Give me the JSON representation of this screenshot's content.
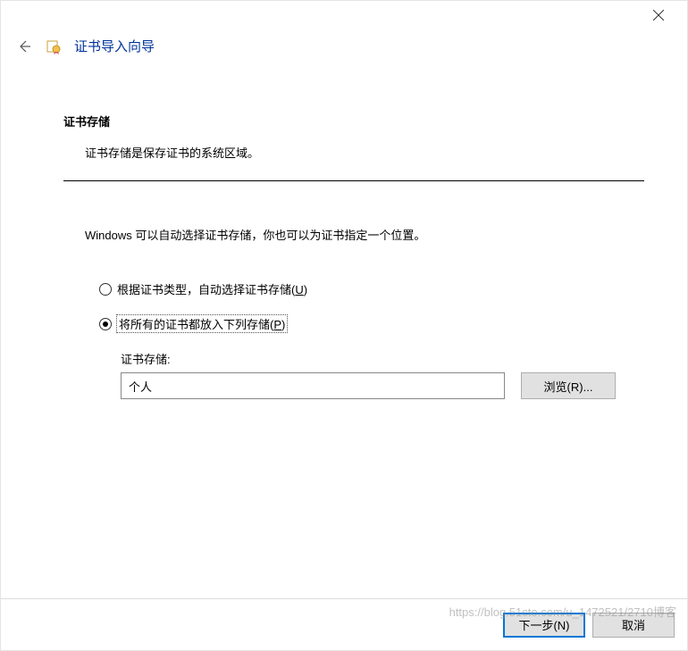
{
  "window": {
    "wizard_title": "证书导入向导"
  },
  "section": {
    "title": "证书存储",
    "description": "证书存储是保存证书的系统区域。",
    "instruction": "Windows 可以自动选择证书存储，你也可以为证书指定一个位置。"
  },
  "radios": {
    "auto": {
      "label_pre": "根据证书类型，自动选择证书存储(",
      "mnemonic": "U",
      "label_post": ")",
      "selected": false
    },
    "manual": {
      "label_pre": "将所有的证书都放入下列存储(",
      "mnemonic": "P",
      "label_post": ")",
      "selected": true
    }
  },
  "store": {
    "label": "证书存储:",
    "value": "个人",
    "browse_label": "浏览(R)..."
  },
  "footer": {
    "next": "下一步(N)",
    "cancel": "取消"
  },
  "watermark": "https://blog.51cto.com/u_1472521/2710博客"
}
